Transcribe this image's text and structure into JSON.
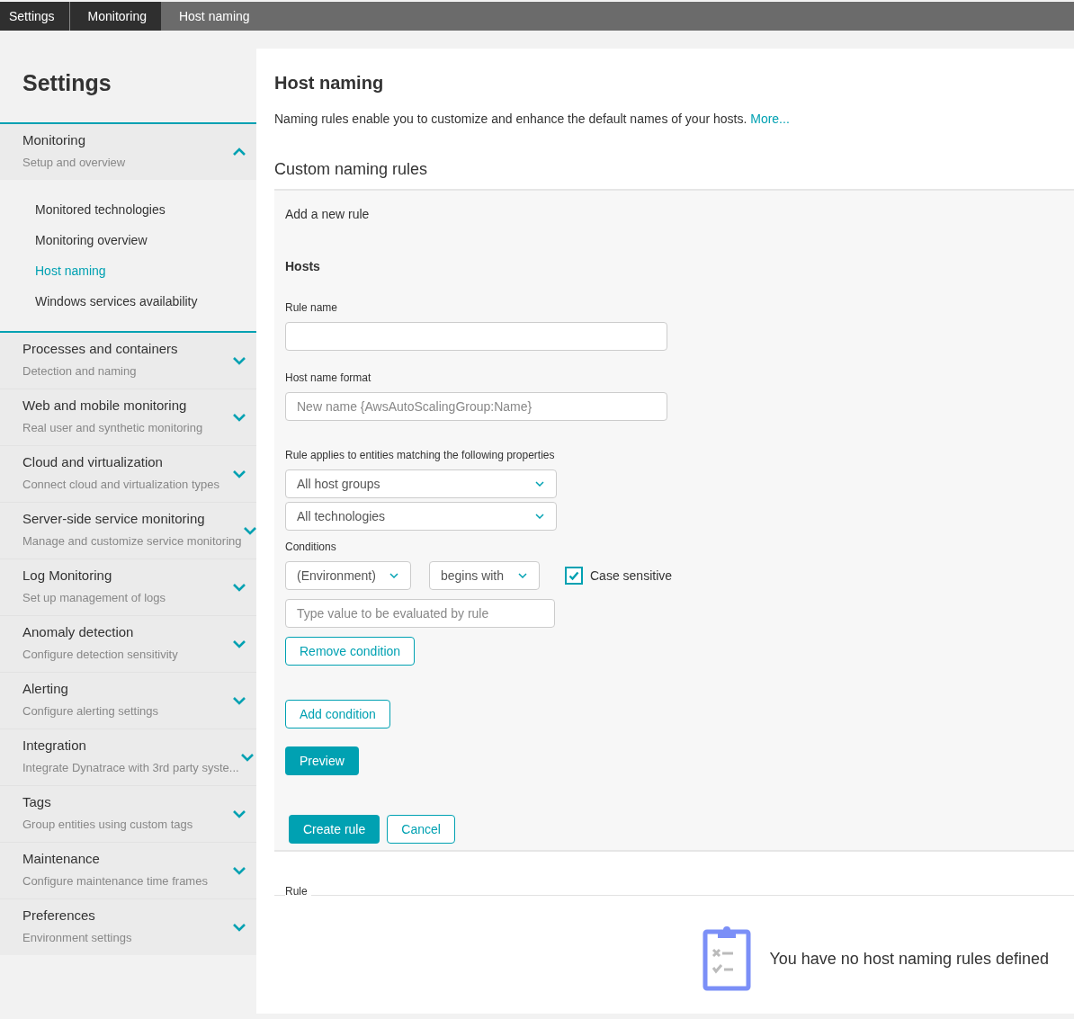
{
  "breadcrumbs": [
    {
      "label": "Settings",
      "current": false
    },
    {
      "label": "Monitoring",
      "current": false
    },
    {
      "label": "Host naming",
      "current": true
    }
  ],
  "sidebar": {
    "title": "Settings",
    "groups": [
      {
        "title": "Monitoring",
        "subtitle": "Setup and overview",
        "expanded": true,
        "children": [
          {
            "label": "Monitored technologies",
            "selected": false
          },
          {
            "label": "Monitoring overview",
            "selected": false
          },
          {
            "label": "Host naming",
            "selected": true
          },
          {
            "label": "Windows services availability",
            "selected": false
          }
        ]
      },
      {
        "title": "Processes and containers",
        "subtitle": "Detection and naming",
        "expanded": false
      },
      {
        "title": "Web and mobile monitoring",
        "subtitle": "Real user and synthetic monitoring",
        "expanded": false
      },
      {
        "title": "Cloud and virtualization",
        "subtitle": "Connect cloud and virtualization types",
        "expanded": false
      },
      {
        "title": "Server-side service monitoring",
        "subtitle": "Manage and customize service monitoring",
        "expanded": false
      },
      {
        "title": "Log Monitoring",
        "subtitle": "Set up management of logs",
        "expanded": false
      },
      {
        "title": "Anomaly detection",
        "subtitle": "Configure detection sensitivity",
        "expanded": false
      },
      {
        "title": "Alerting",
        "subtitle": "Configure alerting settings",
        "expanded": false
      },
      {
        "title": "Integration",
        "subtitle": "Integrate Dynatrace with 3rd party syste...",
        "expanded": false
      },
      {
        "title": "Tags",
        "subtitle": "Group entities using custom tags",
        "expanded": false
      },
      {
        "title": "Maintenance",
        "subtitle": "Configure maintenance time frames",
        "expanded": false
      },
      {
        "title": "Preferences",
        "subtitle": "Environment settings",
        "expanded": false
      }
    ]
  },
  "page": {
    "title": "Host naming",
    "description": "Naming rules enable you to customize and enhance the default names of your hosts.",
    "more_link": "More...",
    "section_title": "Custom naming rules"
  },
  "form": {
    "heading": "Add a new rule",
    "subheading": "Hosts",
    "rule_name_label": "Rule name",
    "host_name_format_label": "Host name format",
    "host_name_format_placeholder": "New name {AwsAutoScalingGroup:Name}",
    "properties_label": "Rule applies to entities matching the following properties",
    "property_dropdowns": [
      "All host groups",
      "All technologies"
    ],
    "conditions_label": "Conditions",
    "condition": {
      "property": "(Environment)",
      "operator": "begins with",
      "case_sensitive_label": "Case sensitive",
      "case_sensitive": true,
      "value_placeholder": "Type value to be evaluated by rule"
    },
    "remove_condition": "Remove condition",
    "add_condition": "Add condition",
    "preview": "Preview",
    "create": "Create rule",
    "cancel": "Cancel"
  },
  "table": {
    "column": "Rule",
    "empty_message": "You have no host naming rules defined"
  }
}
